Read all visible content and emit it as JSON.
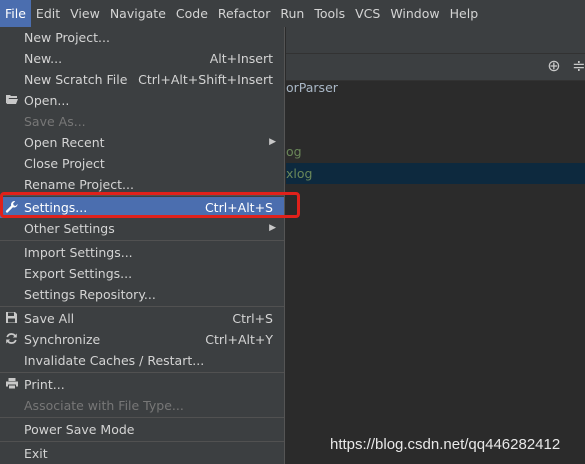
{
  "menubar": [
    {
      "label": "File",
      "active": true
    },
    {
      "label": "Edit"
    },
    {
      "label": "View"
    },
    {
      "label": "Navigate"
    },
    {
      "label": "Code"
    },
    {
      "label": "Refactor"
    },
    {
      "label": "Run"
    },
    {
      "label": "Tools"
    },
    {
      "label": "VCS"
    },
    {
      "label": "Window"
    },
    {
      "label": "Help"
    }
  ],
  "file_menu": {
    "new_project": "New Project...",
    "new": "New...",
    "new_shortcut": "Alt+Insert",
    "new_scratch": "New Scratch File",
    "new_scratch_shortcut": "Ctrl+Alt+Shift+Insert",
    "open": "Open...",
    "save_as": "Save As...",
    "open_recent": "Open Recent",
    "close_project": "Close Project",
    "rename_project": "Rename Project...",
    "settings": "Settings...",
    "settings_shortcut": "Ctrl+Alt+S",
    "other_settings": "Other Settings",
    "import_settings": "Import Settings...",
    "export_settings": "Export Settings...",
    "settings_repository": "Settings Repository...",
    "save_all": "Save All",
    "save_all_shortcut": "Ctrl+S",
    "synchronize": "Synchronize",
    "synchronize_shortcut": "Ctrl+Alt+Y",
    "invalidate_caches": "Invalidate Caches / Restart...",
    "print": "Print...",
    "associate": "Associate with File Type...",
    "power_save": "Power Save Mode",
    "exit": "Exit"
  },
  "project_tree": {
    "line1": "orParser",
    "line2": "og",
    "line3": "xlog"
  },
  "watermark": "https://blog.csdn.net/qq446282412",
  "colors": {
    "selection": "#4b6eaf",
    "highlight_border": "#e0211b",
    "tree_green": "#6a8759",
    "tree_selection": "#0d293e"
  },
  "icons": {
    "open": "folder-icon",
    "settings": "wrench-icon",
    "save_all": "floppy-icon",
    "synchronize": "sync-icon",
    "print": "printer-icon"
  }
}
